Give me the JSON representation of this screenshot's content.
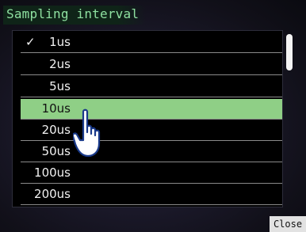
{
  "dialog": {
    "title": "Sampling interval"
  },
  "list": {
    "items": [
      {
        "label": "1us",
        "checked": true
      },
      {
        "label": "2us"
      },
      {
        "label": "5us"
      },
      {
        "label": "10us",
        "selected": true
      },
      {
        "label": "20us"
      },
      {
        "label": "50us"
      },
      {
        "label": "100us"
      },
      {
        "label": "200us"
      }
    ],
    "check_glyph": "✓"
  },
  "buttons": {
    "close_label": "Close"
  },
  "icons": {
    "checkmark": "check-icon",
    "pointer": "hand-pointer-icon"
  },
  "colors": {
    "title_text": "#8ee0a0",
    "selected_row": "#8fcf86",
    "list_background": "#000000"
  }
}
